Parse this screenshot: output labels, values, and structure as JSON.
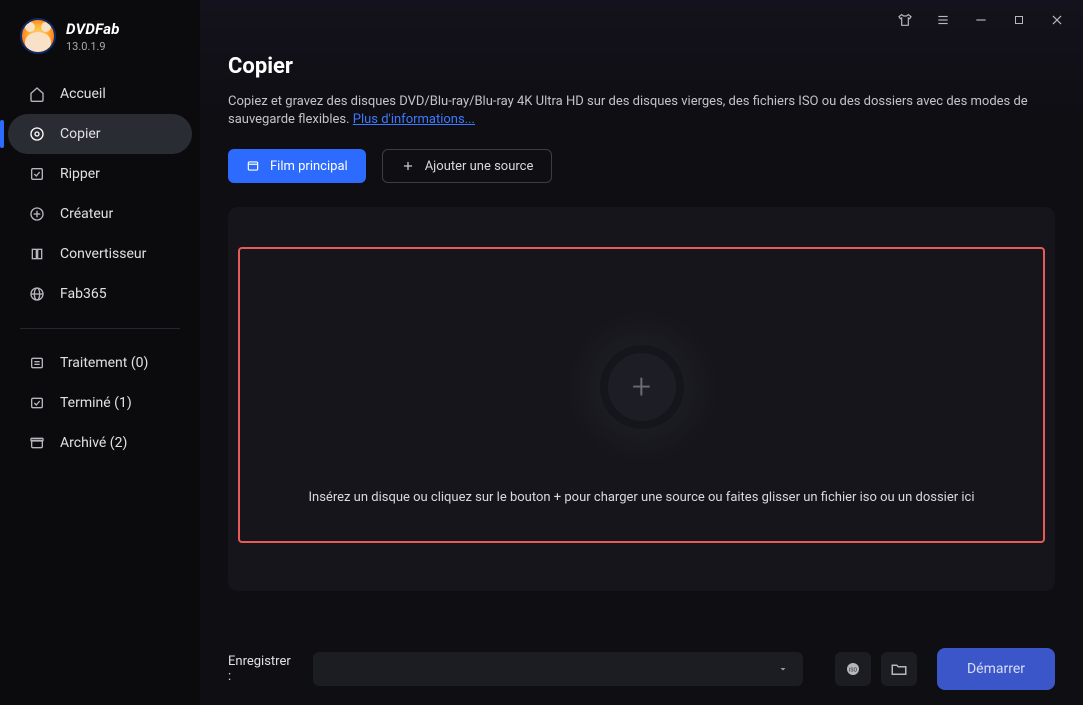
{
  "app": {
    "name": "DVDFab",
    "version": "13.0.1.9"
  },
  "sidebar": {
    "items": [
      {
        "label": "Accueil",
        "icon": "home-icon"
      },
      {
        "label": "Copier",
        "icon": "disc-icon"
      },
      {
        "label": "Ripper",
        "icon": "rip-icon"
      },
      {
        "label": "Créateur",
        "icon": "creator-icon"
      },
      {
        "label": "Convertisseur",
        "icon": "convert-icon"
      },
      {
        "label": "Fab365",
        "icon": "globe-icon"
      }
    ],
    "queue": [
      {
        "label": "Traitement (0)",
        "icon": "processing-icon"
      },
      {
        "label": "Terminé (1)",
        "icon": "done-icon"
      },
      {
        "label": "Archivé (2)",
        "icon": "archive-icon"
      }
    ]
  },
  "page": {
    "title": "Copier",
    "description_prefix": "Copiez et gravez des disques DVD/Blu-ray/Blu-ray 4K Ultra HD sur des disques vierges, des fichiers ISO ou des dossiers avec des modes de sauvegarde flexibles. ",
    "more_info": "Plus d'informations...",
    "film_principal": "Film principal",
    "add_source": "Ajouter une source",
    "dropzone_text": "Insérez un disque ou cliquez sur le bouton +  pour charger une source ou faites glisser un fichier iso ou un dossier ici"
  },
  "footer": {
    "save_label": "Enregistrer :",
    "start": "Démarrer"
  }
}
